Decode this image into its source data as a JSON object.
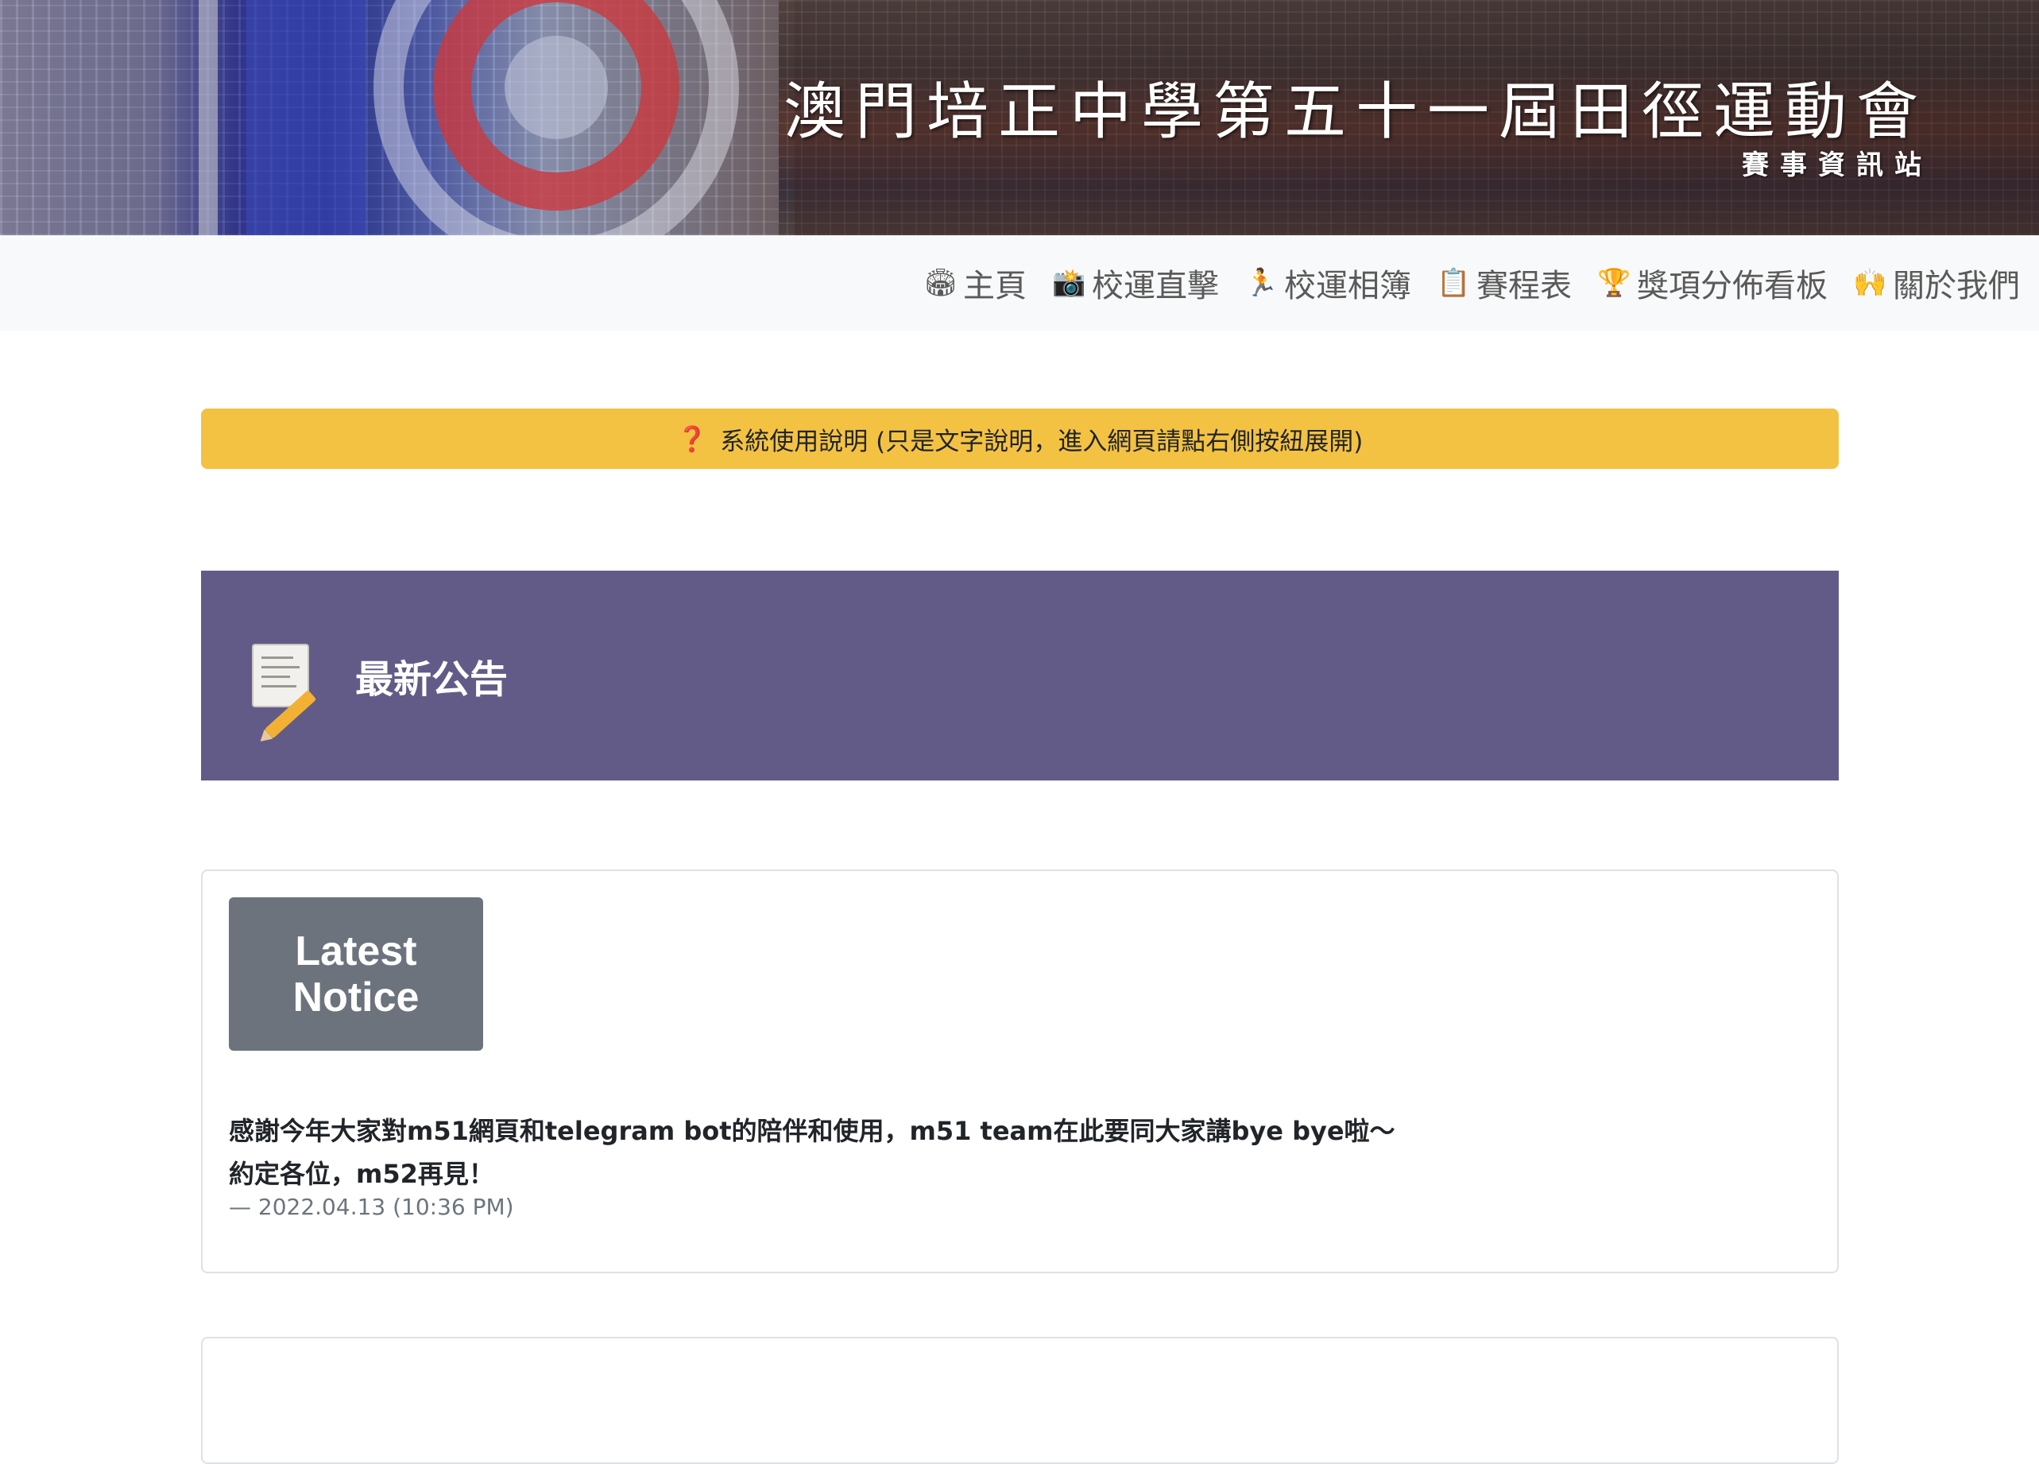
{
  "banner": {
    "title": "澳門培正中學第五十一屆田徑運動會",
    "subtitle": "賽事資訊站"
  },
  "navbar": {
    "items": [
      {
        "icon": "stadium-icon",
        "emoji": "🏟",
        "label": "主頁"
      },
      {
        "icon": "camera-flash-icon",
        "emoji": "📸",
        "label": "校運直擊"
      },
      {
        "icon": "runner-icon",
        "emoji": "🏃",
        "label": "校運相簿"
      },
      {
        "icon": "clipboard-icon",
        "emoji": "📋",
        "label": "賽程表"
      },
      {
        "icon": "trophy-icon",
        "emoji": "🏆",
        "label": "獎項分佈看板"
      },
      {
        "icon": "raised-hands-icon",
        "emoji": "🙌",
        "label": "關於我們"
      }
    ]
  },
  "usage": {
    "icon": "❓",
    "text": "系統使用說明 (只是文字說明，進入網頁請點右側按紐展開)"
  },
  "section": {
    "icon": "memo-icon",
    "title": "最新公告"
  },
  "notice": {
    "badge_line1": "Latest",
    "badge_line2": "Notice",
    "line1": "感謝今年大家對m51網頁和telegram bot的陪伴和使用，m51 team在此要同大家講bye bye啦～",
    "line2": "約定各位，m52再見！",
    "date": "— 2022.04.13 (10:36 PM)"
  },
  "colors": {
    "navbar_bg": "#f8f9fa",
    "usage_bg": "#f4c242",
    "section_bg": "#635b87",
    "badge_bg": "#6c737d"
  }
}
